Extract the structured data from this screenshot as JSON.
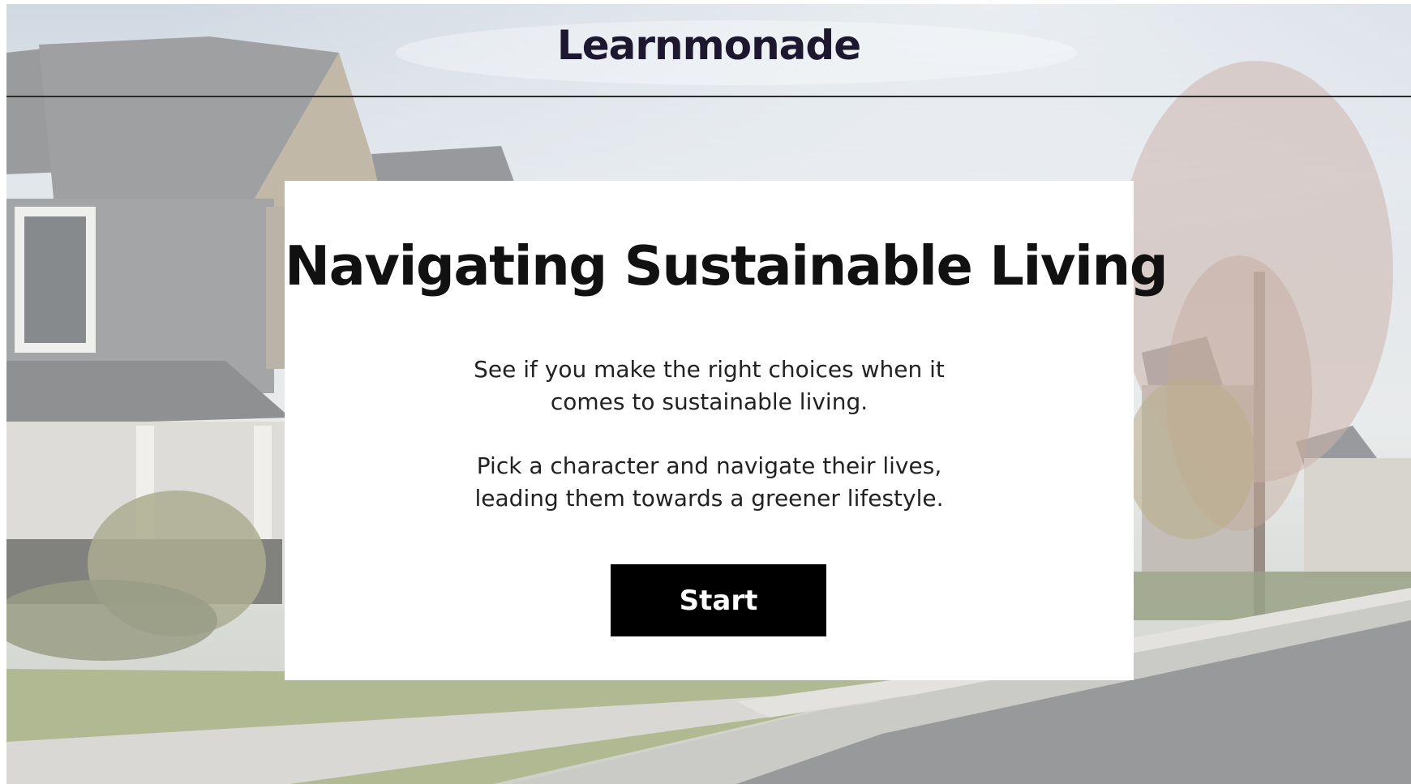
{
  "header": {
    "logo_text": "Learnmonade"
  },
  "card": {
    "title": "Navigating Sustainable Living",
    "paragraph_1_line_1": "See if you make the right choices when it",
    "paragraph_1_line_2": "comes to sustainable living.",
    "paragraph_2_line_1": "Pick a character and navigate their lives,",
    "paragraph_2_line_2": "leading them towards a greener lifestyle.",
    "start_label": "Start"
  },
  "colors": {
    "logo": "#1d1830",
    "button_bg": "#000000",
    "button_text": "#ffffff",
    "card_bg": "#ffffff"
  }
}
